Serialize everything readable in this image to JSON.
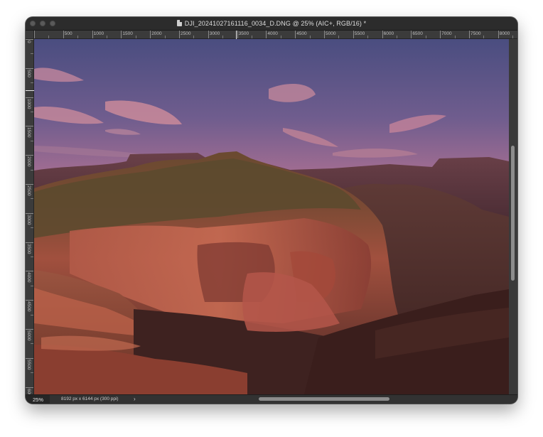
{
  "window": {
    "title": "DJI_20241027161116_0034_D.DNG @ 25% (AIC+, RGB/16) *"
  },
  "rulers": {
    "horizontal_labels": [
      "500",
      "1000",
      "1500",
      "2000",
      "2500",
      "3000",
      "3500",
      "4000",
      "4500",
      "5000",
      "5500",
      "6000",
      "6500",
      "7000",
      "7500",
      "8000"
    ],
    "vertical_labels": [
      "0",
      "500",
      "1000",
      "1500",
      "2000",
      "2500",
      "3000",
      "3500",
      "4000",
      "4500",
      "5000",
      "5500",
      "6000"
    ]
  },
  "canvas": {
    "image_description": "sunset canyon landscape"
  },
  "status": {
    "zoom": "25%",
    "doc_info": "8192 px x 6144 px (300 ppi)",
    "chevron": "›"
  },
  "colors": {
    "window_bg": "#3a3a3a",
    "titlebar_bg": "#2c2c2c",
    "sky_top": "#4f4f82",
    "sky_bottom": "#b07290",
    "cloud": "#d38a9a",
    "rock_lit": "#b4594a",
    "rock_shadow": "#4a2a28"
  }
}
